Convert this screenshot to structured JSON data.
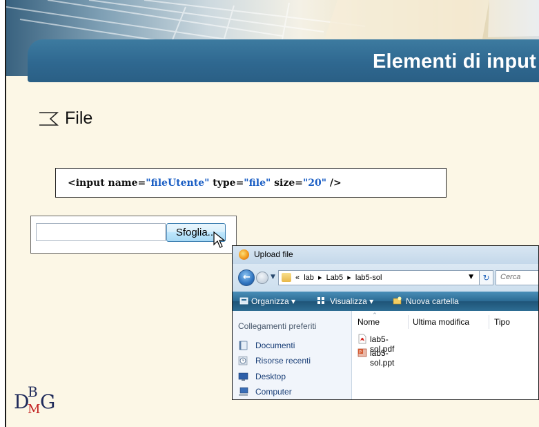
{
  "slide": {
    "title": "Elementi di input",
    "bullet": "File"
  },
  "code": {
    "tag_open": "<input",
    "attr1": " name=",
    "val1": "\"fileUtente\"",
    "attr2": " type=",
    "val2": "\"file\"",
    "attr3": " size=",
    "val3": "\"20\"",
    "tag_close": " />"
  },
  "file_input": {
    "value": "",
    "browse_label": "Sfoglia..."
  },
  "dialog": {
    "title": "Upload file",
    "path": "«  lab  ▸  Lab5  ▸  lab5-sol",
    "search_placeholder": "Cerca",
    "toolbar": {
      "organize": "Organizza",
      "views": "Visualizza",
      "new_folder": "Nuova cartella"
    },
    "sidebar": {
      "header": "Collegamenti preferiti",
      "items": [
        {
          "label": "Documenti",
          "icon": "documents-icon"
        },
        {
          "label": "Risorse recenti",
          "icon": "recent-items-icon"
        },
        {
          "label": "Desktop",
          "icon": "desktop-icon"
        },
        {
          "label": "Computer",
          "icon": "computer-icon"
        }
      ]
    },
    "columns": [
      "Nome",
      "Ultima modifica",
      "Tipo"
    ],
    "files": [
      {
        "name": "lab5-sol.pdf",
        "icon": "pdf-file-icon"
      },
      {
        "name": "lab5-sol.ppt",
        "icon": "ppt-file-icon"
      }
    ]
  },
  "logo": {
    "d": "D",
    "b": "B",
    "m": "M",
    "g": "G"
  },
  "colors": {
    "title_bar": "#2f6890",
    "page_bg": "#fcf7e6",
    "code_string": "#1a5ec4",
    "logo_blue": "#1e2a5a",
    "logo_red": "#c2201f"
  }
}
